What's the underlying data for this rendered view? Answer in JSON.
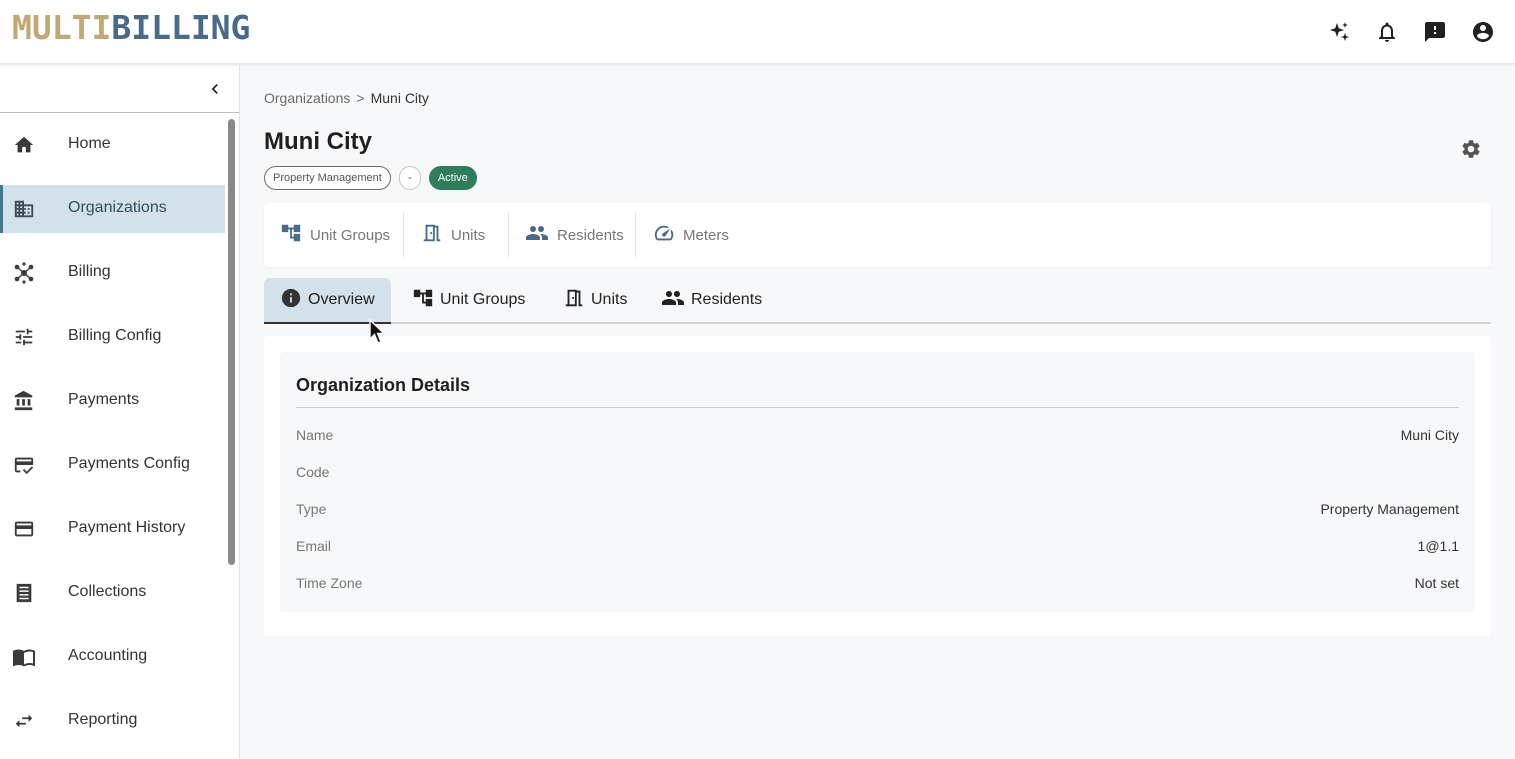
{
  "header": {
    "logo_part1": "MULTI",
    "logo_part2": "BILLING",
    "icons": [
      "sparkle-icon",
      "bell-icon",
      "feedback-icon",
      "account-icon"
    ]
  },
  "sidebar": {
    "items": [
      {
        "label": "Home",
        "icon": "home-icon"
      },
      {
        "label": "Organizations",
        "icon": "building-icon",
        "active": true
      },
      {
        "label": "Billing",
        "icon": "billing-hub-icon"
      },
      {
        "label": "Billing Config",
        "icon": "tune-icon"
      },
      {
        "label": "Payments",
        "icon": "bank-icon"
      },
      {
        "label": "Payments Config",
        "icon": "card-check-icon"
      },
      {
        "label": "Payment History",
        "icon": "credit-card-icon"
      },
      {
        "label": "Collections",
        "icon": "receipt-icon"
      },
      {
        "label": "Accounting",
        "icon": "book-icon"
      },
      {
        "label": "Reporting",
        "icon": "swap-icon"
      }
    ]
  },
  "breadcrumb": {
    "parent": "Organizations",
    "separator": ">",
    "current": "Muni City"
  },
  "page": {
    "title": "Muni City",
    "chips": {
      "type": "Property Management",
      "dash": "-",
      "status": "Active"
    }
  },
  "stats": {
    "unit_groups": "Unit Groups",
    "units": "Units",
    "residents": "Residents",
    "meters": "Meters"
  },
  "tabs": {
    "overview": "Overview",
    "unit_groups": "Unit Groups",
    "units": "Units",
    "residents": "Residents"
  },
  "details": {
    "title": "Organization Details",
    "rows": [
      {
        "label": "Name",
        "value": "Muni City"
      },
      {
        "label": "Code",
        "value": ""
      },
      {
        "label": "Type",
        "value": "Property Management"
      },
      {
        "label": "Email",
        "value": "1@1.1"
      },
      {
        "label": "Time Zone",
        "value": "Not set"
      }
    ]
  },
  "colors": {
    "accent": "#3d7a96",
    "active_nav_bg": "#d3e2ea",
    "status_green": "#2e7d5b",
    "logo_gold": "#c0a878",
    "logo_blue": "#4a6a8a"
  }
}
